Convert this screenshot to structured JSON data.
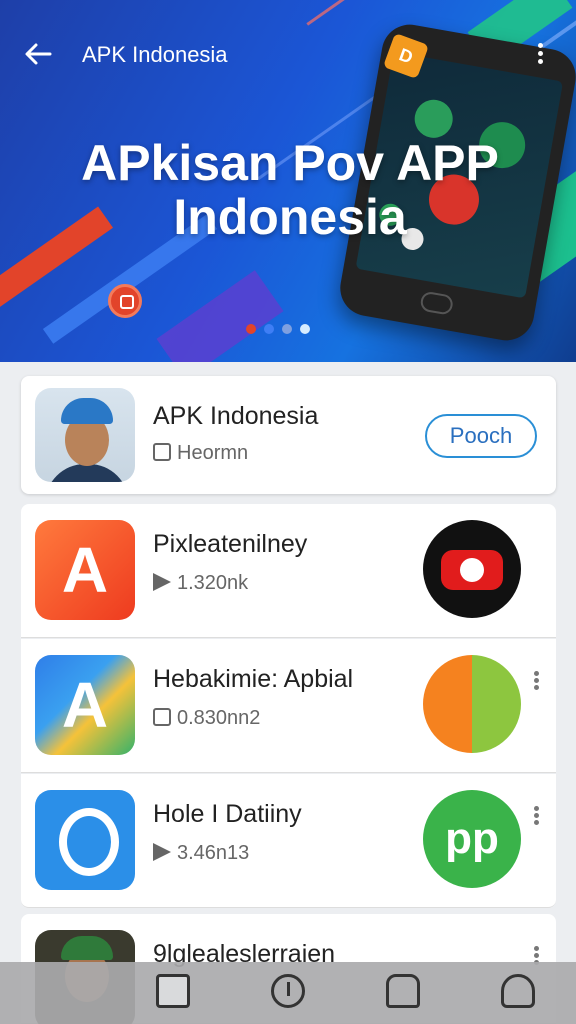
{
  "header": {
    "title": "APK Indonesia",
    "back_icon": "back-arrow-icon",
    "more_icon": "more-vert-icon"
  },
  "banner": {
    "headline_line1": "APkisan Pov APP",
    "headline_line2": "Indonesia",
    "badge_letter": "D",
    "pager": {
      "count": 4,
      "active_index": 0
    }
  },
  "apps": [
    {
      "name": "APK Indonesia",
      "meta": "Heormn",
      "action_label": "Pooch",
      "icon": "avatar-photo-icon"
    },
    {
      "name": "Pixleatenilney",
      "meta": "1.320nk",
      "icon_letter": "A",
      "side_icon": "camera-app-icon"
    },
    {
      "name": "Hebakimie: Apbial",
      "meta": "0.830nn2",
      "icon_letter": "A",
      "side_icon": "android-icon"
    },
    {
      "name": "Hole I Datiiny",
      "meta": "3.46n13",
      "icon": "p-logo-icon",
      "side_icon_text": "pp"
    },
    {
      "name": "9lglealeslerraien",
      "icon": "avatar-photo-icon"
    }
  ],
  "bottom_nav": [
    "home-icon",
    "clock-icon",
    "map-icon",
    "profile-icon"
  ],
  "colors": {
    "hero_blue": "#1b56d6",
    "accent_orange": "#ee3b1f",
    "accent_green": "#3ab34a",
    "link_blue": "#2a8fd6"
  }
}
